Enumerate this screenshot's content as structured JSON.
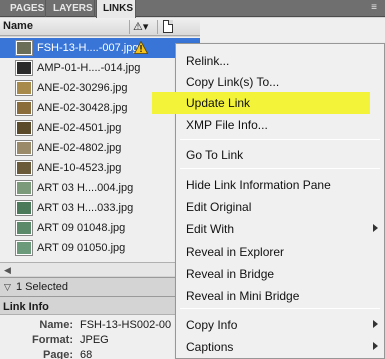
{
  "tabs": [
    {
      "label": "PAGES"
    },
    {
      "label": "LAYERS"
    },
    {
      "label": "LINKS"
    }
  ],
  "tab_close": "×",
  "panel_menu_icon": "≡",
  "columns": {
    "name": "Name",
    "warning_icon": "warning-sort-icon",
    "page_icon": "page-column-icon"
  },
  "links": [
    {
      "name": "FSH-13-H....-007.jpg",
      "thumb": "#6b6f58",
      "selected": true,
      "warning": true
    },
    {
      "name": "AMP-01-H....-014.jpg",
      "thumb": "#2a2a2a",
      "selected": false,
      "warning": false
    },
    {
      "name": "ANE-02-30296.jpg",
      "thumb": "#a88a4a",
      "selected": false,
      "warning": false
    },
    {
      "name": "ANE-02-30428.jpg",
      "thumb": "#8a6b3a",
      "selected": false,
      "warning": false
    },
    {
      "name": "ANE-02-4501.jpg",
      "thumb": "#5a4a2a",
      "selected": false,
      "warning": false
    },
    {
      "name": "ANE-02-4802.jpg",
      "thumb": "#9a8a6a",
      "selected": false,
      "warning": false
    },
    {
      "name": "ANE-10-4523.jpg",
      "thumb": "#6a5a3a",
      "selected": false,
      "warning": false
    },
    {
      "name": "ART 03 H....004.jpg",
      "thumb": "#7a9a7a",
      "selected": false,
      "warning": false
    },
    {
      "name": "ART 03 H....033.jpg",
      "thumb": "#4a7a5a",
      "selected": false,
      "warning": false
    },
    {
      "name": "ART 09 01048.jpg",
      "thumb": "#5a8a6a",
      "selected": false,
      "warning": false
    },
    {
      "name": "ART 09 01050.jpg",
      "thumb": "#6a9a7a",
      "selected": false,
      "warning": false
    }
  ],
  "status": {
    "selected_text": "1 Selected"
  },
  "link_info": {
    "title": "Link Info",
    "fields": [
      {
        "key": "Name:",
        "value": "FSH-13-HS002-00"
      },
      {
        "key": "Format:",
        "value": "JPEG"
      },
      {
        "key": "Page:",
        "value": "68"
      }
    ]
  },
  "context_menu": {
    "items": [
      {
        "label": "Relink...",
        "submenu": false,
        "highlight": false
      },
      {
        "label": "Copy Link(s) To...",
        "submenu": false,
        "highlight": false
      },
      {
        "label": "Update Link",
        "submenu": false,
        "highlight": true
      },
      {
        "label": "XMP File Info...",
        "submenu": false,
        "highlight": false
      },
      {
        "label": "Go To Link",
        "submenu": false,
        "highlight": false
      },
      {
        "label": "Hide Link Information Pane",
        "submenu": false,
        "highlight": false
      },
      {
        "label": "Edit Original",
        "submenu": false,
        "highlight": false
      },
      {
        "label": "Edit With",
        "submenu": true,
        "highlight": false
      },
      {
        "label": "Reveal in Explorer",
        "submenu": false,
        "highlight": false
      },
      {
        "label": "Reveal in Bridge",
        "submenu": false,
        "highlight": false
      },
      {
        "label": "Reveal in Mini Bridge",
        "submenu": false,
        "highlight": false
      },
      {
        "label": "Copy Info",
        "submenu": true,
        "highlight": false
      },
      {
        "label": "Captions",
        "submenu": true,
        "highlight": false
      }
    ],
    "highlight_color": "#f3f33a"
  },
  "colors": {
    "selection": "#3875d7",
    "tabbar": "#6f6f6f"
  }
}
